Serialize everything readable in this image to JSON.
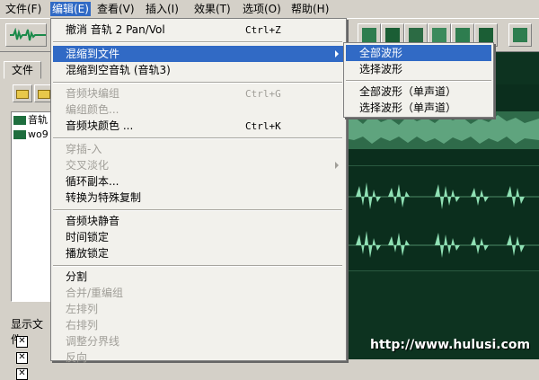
{
  "menubar": {
    "items": [
      "文件(F)",
      "编辑(E)",
      "查看(V)",
      "插入(I)",
      "效果(T)",
      "选项(O)",
      "帮助(H)"
    ],
    "active": "编辑(E)"
  },
  "left_panel": {
    "tab_label": "文件",
    "files": [
      "音轨",
      "wo9"
    ],
    "show_files_label": "显示文件"
  },
  "edit_menu": {
    "items": [
      {
        "label": "撤消 音轨  2 Pan/Vol",
        "shortcut": "Ctrl+Z",
        "enabled": true
      },
      {
        "label": "混缩到文件",
        "shortcut": "",
        "enabled": true,
        "highlighted": true,
        "submenu": true
      },
      {
        "label": "混缩到空音轨 (音轨3)",
        "shortcut": "",
        "enabled": true
      },
      {
        "label": "音频块编组",
        "shortcut": "Ctrl+G",
        "enabled": false
      },
      {
        "label": "编组颜色...",
        "shortcut": "",
        "enabled": false
      },
      {
        "label": "音频块颜色 ...",
        "shortcut": "Ctrl+K",
        "enabled": true
      },
      {
        "label": "穿插-入",
        "shortcut": "",
        "enabled": false
      },
      {
        "label": "交叉淡化",
        "shortcut": "",
        "enabled": false,
        "submenu": true
      },
      {
        "label": "循环副本...",
        "shortcut": "",
        "enabled": true
      },
      {
        "label": "转换为特殊复制",
        "shortcut": "",
        "enabled": true
      },
      {
        "label": "音频块静音",
        "shortcut": "",
        "enabled": true
      },
      {
        "label": "时间锁定",
        "shortcut": "",
        "enabled": true
      },
      {
        "label": "播放锁定",
        "shortcut": "",
        "enabled": true
      },
      {
        "label": "分割",
        "shortcut": "",
        "enabled": true
      },
      {
        "label": "合并/重编组",
        "shortcut": "",
        "enabled": false
      },
      {
        "label": "左排列",
        "shortcut": "",
        "enabled": false
      },
      {
        "label": "右排列",
        "shortcut": "",
        "enabled": false
      },
      {
        "label": "调整分界线",
        "shortcut": "",
        "enabled": false
      },
      {
        "label": "反向",
        "shortcut": "",
        "enabled": false
      }
    ]
  },
  "submenu": {
    "items": [
      {
        "label": "全部波形",
        "highlighted": true
      },
      {
        "label": "选择波形",
        "highlighted": false
      },
      {
        "label": "全部波形（单声道）",
        "highlighted": false
      },
      {
        "label": "选择波形（单声道）",
        "highlighted": false
      }
    ]
  },
  "watermark": "http://www.hulusi.com",
  "colors": {
    "highlight": "#316ac5",
    "wave": "#8fe0b4",
    "wave_bg": "#0b2e1d"
  }
}
